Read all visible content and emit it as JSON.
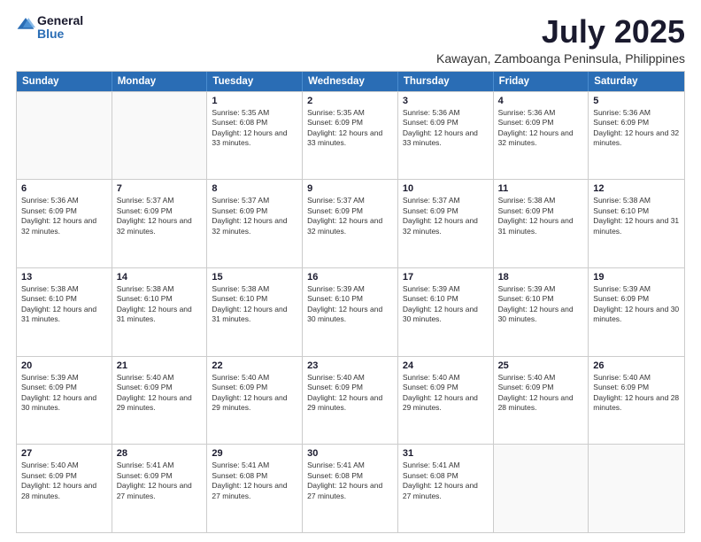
{
  "logo": {
    "line1": "General",
    "line2": "Blue"
  },
  "title": "July 2025",
  "subtitle": "Kawayan, Zamboanga Peninsula, Philippines",
  "header_days": [
    "Sunday",
    "Monday",
    "Tuesday",
    "Wednesday",
    "Thursday",
    "Friday",
    "Saturday"
  ],
  "weeks": [
    [
      {
        "day": "",
        "sunrise": "",
        "sunset": "",
        "daylight": ""
      },
      {
        "day": "",
        "sunrise": "",
        "sunset": "",
        "daylight": ""
      },
      {
        "day": "1",
        "sunrise": "Sunrise: 5:35 AM",
        "sunset": "Sunset: 6:08 PM",
        "daylight": "Daylight: 12 hours and 33 minutes."
      },
      {
        "day": "2",
        "sunrise": "Sunrise: 5:35 AM",
        "sunset": "Sunset: 6:09 PM",
        "daylight": "Daylight: 12 hours and 33 minutes."
      },
      {
        "day": "3",
        "sunrise": "Sunrise: 5:36 AM",
        "sunset": "Sunset: 6:09 PM",
        "daylight": "Daylight: 12 hours and 33 minutes."
      },
      {
        "day": "4",
        "sunrise": "Sunrise: 5:36 AM",
        "sunset": "Sunset: 6:09 PM",
        "daylight": "Daylight: 12 hours and 32 minutes."
      },
      {
        "day": "5",
        "sunrise": "Sunrise: 5:36 AM",
        "sunset": "Sunset: 6:09 PM",
        "daylight": "Daylight: 12 hours and 32 minutes."
      }
    ],
    [
      {
        "day": "6",
        "sunrise": "Sunrise: 5:36 AM",
        "sunset": "Sunset: 6:09 PM",
        "daylight": "Daylight: 12 hours and 32 minutes."
      },
      {
        "day": "7",
        "sunrise": "Sunrise: 5:37 AM",
        "sunset": "Sunset: 6:09 PM",
        "daylight": "Daylight: 12 hours and 32 minutes."
      },
      {
        "day": "8",
        "sunrise": "Sunrise: 5:37 AM",
        "sunset": "Sunset: 6:09 PM",
        "daylight": "Daylight: 12 hours and 32 minutes."
      },
      {
        "day": "9",
        "sunrise": "Sunrise: 5:37 AM",
        "sunset": "Sunset: 6:09 PM",
        "daylight": "Daylight: 12 hours and 32 minutes."
      },
      {
        "day": "10",
        "sunrise": "Sunrise: 5:37 AM",
        "sunset": "Sunset: 6:09 PM",
        "daylight": "Daylight: 12 hours and 32 minutes."
      },
      {
        "day": "11",
        "sunrise": "Sunrise: 5:38 AM",
        "sunset": "Sunset: 6:09 PM",
        "daylight": "Daylight: 12 hours and 31 minutes."
      },
      {
        "day": "12",
        "sunrise": "Sunrise: 5:38 AM",
        "sunset": "Sunset: 6:10 PM",
        "daylight": "Daylight: 12 hours and 31 minutes."
      }
    ],
    [
      {
        "day": "13",
        "sunrise": "Sunrise: 5:38 AM",
        "sunset": "Sunset: 6:10 PM",
        "daylight": "Daylight: 12 hours and 31 minutes."
      },
      {
        "day": "14",
        "sunrise": "Sunrise: 5:38 AM",
        "sunset": "Sunset: 6:10 PM",
        "daylight": "Daylight: 12 hours and 31 minutes."
      },
      {
        "day": "15",
        "sunrise": "Sunrise: 5:38 AM",
        "sunset": "Sunset: 6:10 PM",
        "daylight": "Daylight: 12 hours and 31 minutes."
      },
      {
        "day": "16",
        "sunrise": "Sunrise: 5:39 AM",
        "sunset": "Sunset: 6:10 PM",
        "daylight": "Daylight: 12 hours and 30 minutes."
      },
      {
        "day": "17",
        "sunrise": "Sunrise: 5:39 AM",
        "sunset": "Sunset: 6:10 PM",
        "daylight": "Daylight: 12 hours and 30 minutes."
      },
      {
        "day": "18",
        "sunrise": "Sunrise: 5:39 AM",
        "sunset": "Sunset: 6:10 PM",
        "daylight": "Daylight: 12 hours and 30 minutes."
      },
      {
        "day": "19",
        "sunrise": "Sunrise: 5:39 AM",
        "sunset": "Sunset: 6:09 PM",
        "daylight": "Daylight: 12 hours and 30 minutes."
      }
    ],
    [
      {
        "day": "20",
        "sunrise": "Sunrise: 5:39 AM",
        "sunset": "Sunset: 6:09 PM",
        "daylight": "Daylight: 12 hours and 30 minutes."
      },
      {
        "day": "21",
        "sunrise": "Sunrise: 5:40 AM",
        "sunset": "Sunset: 6:09 PM",
        "daylight": "Daylight: 12 hours and 29 minutes."
      },
      {
        "day": "22",
        "sunrise": "Sunrise: 5:40 AM",
        "sunset": "Sunset: 6:09 PM",
        "daylight": "Daylight: 12 hours and 29 minutes."
      },
      {
        "day": "23",
        "sunrise": "Sunrise: 5:40 AM",
        "sunset": "Sunset: 6:09 PM",
        "daylight": "Daylight: 12 hours and 29 minutes."
      },
      {
        "day": "24",
        "sunrise": "Sunrise: 5:40 AM",
        "sunset": "Sunset: 6:09 PM",
        "daylight": "Daylight: 12 hours and 29 minutes."
      },
      {
        "day": "25",
        "sunrise": "Sunrise: 5:40 AM",
        "sunset": "Sunset: 6:09 PM",
        "daylight": "Daylight: 12 hours and 28 minutes."
      },
      {
        "day": "26",
        "sunrise": "Sunrise: 5:40 AM",
        "sunset": "Sunset: 6:09 PM",
        "daylight": "Daylight: 12 hours and 28 minutes."
      }
    ],
    [
      {
        "day": "27",
        "sunrise": "Sunrise: 5:40 AM",
        "sunset": "Sunset: 6:09 PM",
        "daylight": "Daylight: 12 hours and 28 minutes."
      },
      {
        "day": "28",
        "sunrise": "Sunrise: 5:41 AM",
        "sunset": "Sunset: 6:09 PM",
        "daylight": "Daylight: 12 hours and 27 minutes."
      },
      {
        "day": "29",
        "sunrise": "Sunrise: 5:41 AM",
        "sunset": "Sunset: 6:08 PM",
        "daylight": "Daylight: 12 hours and 27 minutes."
      },
      {
        "day": "30",
        "sunrise": "Sunrise: 5:41 AM",
        "sunset": "Sunset: 6:08 PM",
        "daylight": "Daylight: 12 hours and 27 minutes."
      },
      {
        "day": "31",
        "sunrise": "Sunrise: 5:41 AM",
        "sunset": "Sunset: 6:08 PM",
        "daylight": "Daylight: 12 hours and 27 minutes."
      },
      {
        "day": "",
        "sunrise": "",
        "sunset": "",
        "daylight": ""
      },
      {
        "day": "",
        "sunrise": "",
        "sunset": "",
        "daylight": ""
      }
    ]
  ]
}
